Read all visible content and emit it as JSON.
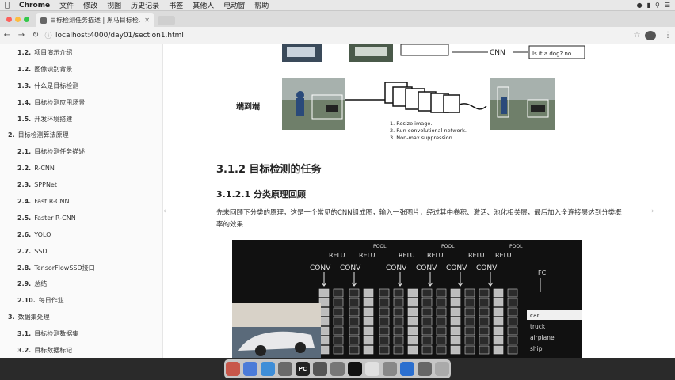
{
  "menubar": {
    "app": "Chrome",
    "items": [
      "文件",
      "修改",
      "视图",
      "历史记录",
      "书签",
      "其他人",
      "电动窗",
      "帮助"
    ]
  },
  "browser": {
    "tab_title": "目标检测任务描述 | 黑马目标检...",
    "url": "localhost:4000/day01/section1.html"
  },
  "sidebar": {
    "items": [
      {
        "num": "1.2.",
        "label": "项目演示介绍",
        "level": 2
      },
      {
        "num": "1.2.",
        "label": "图像识别背景",
        "level": 2
      },
      {
        "num": "1.3.",
        "label": "什么是目标检测",
        "level": 2
      },
      {
        "num": "1.4.",
        "label": "目标检测应用场景",
        "level": 2
      },
      {
        "num": "1.5.",
        "label": "开发环境搭建",
        "level": 2
      },
      {
        "num": "2.",
        "label": "目标检测算法原理",
        "level": 1
      },
      {
        "num": "2.1.",
        "label": "目标检测任务描述",
        "level": 2
      },
      {
        "num": "2.2.",
        "label": "R-CNN",
        "level": 2
      },
      {
        "num": "2.3.",
        "label": "SPPNet",
        "level": 2
      },
      {
        "num": "2.4.",
        "label": "Fast R-CNN",
        "level": 2
      },
      {
        "num": "2.5.",
        "label": "Faster R-CNN",
        "level": 2
      },
      {
        "num": "2.6.",
        "label": "YOLO",
        "level": 2
      },
      {
        "num": "2.7.",
        "label": "SSD",
        "level": 2
      },
      {
        "num": "2.8.",
        "label": "TensorFlowSSD接口",
        "level": 2
      },
      {
        "num": "2.9.",
        "label": "总结",
        "level": 2
      },
      {
        "num": "2.10.",
        "label": "每日作业",
        "level": 2
      },
      {
        "num": "3.",
        "label": "数据集处理",
        "level": 1
      },
      {
        "num": "3.1.",
        "label": "目标检测数据集",
        "level": 2
      },
      {
        "num": "3.2.",
        "label": "目标数据标记",
        "level": 2
      }
    ]
  },
  "content": {
    "fig_top": {
      "cnn_label": "CNN",
      "question": "Is it a dog?  no."
    },
    "fig_pipeline": {
      "label": "端到端",
      "steps": [
        "1. Resize image.",
        "2. Run convolutional network.",
        "3. Non-max suppression."
      ]
    },
    "heading_h3": "3.1.2 目标检测的任务",
    "heading_h4": "3.1.2.1 分类原理回顾",
    "paragraph": "先来回顾下分类的原理，这是一个常见的CNN组成图，输入一张图片，经过其中卷积、激活、池化相关层，最后加入全连接层达到分类概率的效果",
    "cnn_figure": {
      "conv": "CONV",
      "relu": "RELU",
      "pool": "POOL",
      "fc": "FC",
      "classes": [
        "car",
        "truck",
        "airplane",
        "ship"
      ]
    }
  },
  "colors": {
    "menubar_bg": "#e8e8e8",
    "sidebar_bg": "#fafafa",
    "cnn_bg": "#111111",
    "dock_bg": "#d7d7d7"
  }
}
